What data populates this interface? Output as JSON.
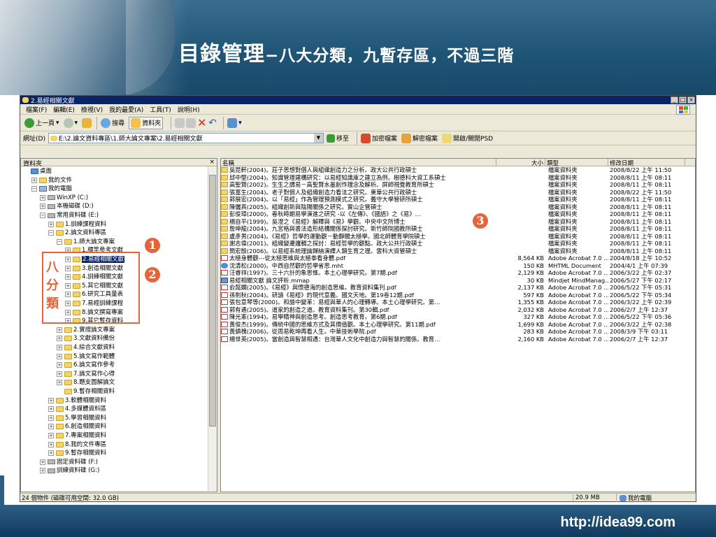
{
  "slide": {
    "title_main": "目錄管理",
    "title_sub": "−八大分類，九暫存區，不過三階",
    "footer_url": "http://idea99.com",
    "category_label_chars": [
      "八",
      "分",
      "類"
    ],
    "callouts": [
      "1",
      "2",
      "3"
    ]
  },
  "window": {
    "title": "2.易經相關文獻",
    "buttons": {
      "min": "_",
      "max": "□",
      "close": "×"
    },
    "menu": [
      "檔案(F)",
      "編輯(E)",
      "檢視(V)",
      "我的最愛(A)",
      "工具(T)",
      "說明(H)"
    ],
    "toolbar": {
      "back": "上一頁",
      "search": "搜尋",
      "folders": "資料夾",
      "views_label": ""
    },
    "address": {
      "label": "網址(D)",
      "value": "E:\\2.論文資料專區\\1.師大論文專案\\2.易經相關文獻",
      "go": "移至",
      "encrypt": "加密檔案",
      "decrypt": "解密檔案",
      "psd": "開啟/關閉PSD"
    },
    "left_pane_title": "資料夾",
    "left_pane_close": "×",
    "tree": [
      {
        "label": "桌面",
        "depth": 0,
        "pm": "",
        "icon": "desktop"
      },
      {
        "label": "我的文件",
        "depth": 1,
        "pm": "+",
        "icon": "folder"
      },
      {
        "label": "我的電腦",
        "depth": 1,
        "pm": "−",
        "icon": "computer"
      },
      {
        "label": "WinXP (C:)",
        "depth": 2,
        "pm": "+",
        "icon": "drive"
      },
      {
        "label": "本機磁碟 (D:)",
        "depth": 2,
        "pm": "+",
        "icon": "drive"
      },
      {
        "label": "常用資料碟 (E:)",
        "depth": 2,
        "pm": "−",
        "icon": "drive"
      },
      {
        "label": "1.訓練課程資料",
        "depth": 3,
        "pm": "+",
        "icon": "folder"
      },
      {
        "label": "2.論文資料專區",
        "depth": 3,
        "pm": "−",
        "icon": "folder"
      },
      {
        "label": "1.師大論文專案",
        "depth": 4,
        "pm": "−",
        "icon": "folder"
      },
      {
        "label": "1.標竿參考文獻",
        "depth": 5,
        "pm": "+",
        "icon": "folder"
      },
      {
        "label": "2.易經相關文獻",
        "depth": 5,
        "pm": "+",
        "icon": "folder",
        "selected": true
      },
      {
        "label": "3.創造相關文獻",
        "depth": 5,
        "pm": "+",
        "icon": "folder"
      },
      {
        "label": "4.訓練相關文獻",
        "depth": 5,
        "pm": "+",
        "icon": "folder"
      },
      {
        "label": "5.其它相關文獻",
        "depth": 5,
        "pm": "+",
        "icon": "folder"
      },
      {
        "label": "6.研究工具量表",
        "depth": 5,
        "pm": "+",
        "icon": "folder"
      },
      {
        "label": "7.易經訓練課程",
        "depth": 5,
        "pm": "+",
        "icon": "folder"
      },
      {
        "label": "8.論文撰寫專案",
        "depth": 5,
        "pm": "+",
        "icon": "folder"
      },
      {
        "label": "9.其它暫存資料",
        "depth": 5,
        "pm": "+",
        "icon": "folder"
      },
      {
        "label": "2.實證論文專案",
        "depth": 4,
        "pm": "+",
        "icon": "folder"
      },
      {
        "label": "3.文獻資料備份",
        "depth": 4,
        "pm": "+",
        "icon": "folder"
      },
      {
        "label": "4.綜合文獻資料",
        "depth": 4,
        "pm": "+",
        "icon": "folder"
      },
      {
        "label": "5.論文寫作範體",
        "depth": 4,
        "pm": "+",
        "icon": "folder"
      },
      {
        "label": "6.論文寫作參考",
        "depth": 4,
        "pm": "+",
        "icon": "folder"
      },
      {
        "label": "7.論文寫作心得",
        "depth": 4,
        "pm": "+",
        "icon": "folder"
      },
      {
        "label": "8.題支圖解論文",
        "depth": 4,
        "pm": "+",
        "icon": "folder"
      },
      {
        "label": "9.暫存相關資料",
        "depth": 4,
        "pm": "",
        "icon": "folder"
      },
      {
        "label": "3.軟體相關資料",
        "depth": 3,
        "pm": "+",
        "icon": "folder"
      },
      {
        "label": "4.多媒體資料區",
        "depth": 3,
        "pm": "+",
        "icon": "folder"
      },
      {
        "label": "5.學習相關資料",
        "depth": 3,
        "pm": "+",
        "icon": "folder"
      },
      {
        "label": "6.創造相關資料",
        "depth": 3,
        "pm": "+",
        "icon": "folder"
      },
      {
        "label": "7.專案相關資料",
        "depth": 3,
        "pm": "+",
        "icon": "folder"
      },
      {
        "label": "8.我的文件專區",
        "depth": 3,
        "pm": "+",
        "icon": "folder"
      },
      {
        "label": "9.暫存相關資料",
        "depth": 3,
        "pm": "+",
        "icon": "folder"
      },
      {
        "label": "固定資料碟 (F:)",
        "depth": 2,
        "pm": "+",
        "icon": "drive"
      },
      {
        "label": "訓練資料碟 (G:)",
        "depth": 2,
        "pm": "+",
        "icon": "drive"
      }
    ],
    "columns": {
      "name": "名稱",
      "size": "大小",
      "type": "類型",
      "date": "修改日期"
    },
    "files": [
      {
        "name": "吳昆軒(2004)。莊子思想對個人與組織創造力之分析。政大公共行政碩士",
        "size": "",
        "type": "檔案資料夾",
        "date": "2008/8/22 上午 11:50",
        "icon": "folder"
      },
      {
        "name": "邱中堅(2004)。知識管理建構研究：以易經知識庫之建立為例。樹德科大資工系碩士",
        "size": "",
        "type": "檔案資料夾",
        "date": "2008/8/11 上午 08:11",
        "icon": "folder"
      },
      {
        "name": "高聖賢(2002)。生生之謂易－高聖賢水墨創作理念及解析。屏師視覺教育所碩士",
        "size": "",
        "type": "檔案資料夾",
        "date": "2008/8/11 上午 08:11",
        "icon": "folder"
      },
      {
        "name": "張富生(2004)。老子對個人及組織創造力看法之研究。東華公共行政碩士",
        "size": "",
        "type": "檔案資料夾",
        "date": "2008/8/22 上午 11:50",
        "icon": "folder"
      },
      {
        "name": "郭展宏(2004)。以「易經」作為管理預測模式之研究。義守大學管研所碩士",
        "size": "",
        "type": "檔案資料夾",
        "date": "2008/8/11 上午 08:11",
        "icon": "folder"
      },
      {
        "name": "陳儷真(2005)。組織創新與陰陽關係之研究。實山企管碩士",
        "size": "",
        "type": "檔案資料夾",
        "date": "2008/8/11 上午 08:11",
        "icon": "folder"
      },
      {
        "name": "彭俊璋(2000)。春秋時期易學演進之研究 -以《左傳》、《國語》之《易》…",
        "size": "",
        "type": "檔案資料夾",
        "date": "2008/8/11 上午 08:11",
        "icon": "folder"
      },
      {
        "name": "楊自平(1999)。吳澄之《易經》解釋與《易》學觀。中央中文所博士",
        "size": "",
        "type": "檔案資料夾",
        "date": "2008/8/11 上午 08:11",
        "icon": "folder"
      },
      {
        "name": "詹坤龍(2004)。九宮格與書法造形結構關係探討研究。新竹師院國教所碩士",
        "size": "",
        "type": "檔案資料夾",
        "date": "2008/8/11 上午 08:11",
        "icon": "folder"
      },
      {
        "name": "盧彥男(2004)。《易經》哲學的運動觀－動靜關太極學。國北師體育學院碩士",
        "size": "",
        "type": "檔案資料夾",
        "date": "2008/8/11 上午 08:11",
        "icon": "folder"
      },
      {
        "name": "謝志偉(2001)。組織變遷邏輯之探討：易經哲學的觀點。政大公共行政碩士",
        "size": "",
        "type": "檔案資料夾",
        "date": "2008/8/11 上午 08:11",
        "icon": "folder"
      },
      {
        "name": "簡宏殷(2006)。以易經系統理論歸納演繹人類生育之理。雲科大資管碩士",
        "size": "",
        "type": "檔案資料夾",
        "date": "2008/8/11 上午 08:11",
        "icon": "folder"
      },
      {
        "name": "太極身體觀---從太極思維與太極拳看身體.pdf",
        "size": "8,564 KB",
        "type": "Adobe Acrobat 7.0 ...",
        "date": "2004/8/18 上午 10:52",
        "icon": "pdf"
      },
      {
        "name": "沈清松(2000)。中西自然觀的哲學省思.mht",
        "size": "150 KB",
        "type": "MHTML Document",
        "date": "2004/4/1 上午 07:39",
        "icon": "mht"
      },
      {
        "name": "汪睿祥(1997)。三十六計的象思惟。本土心理學研究。第7期.pdf",
        "size": "2,129 KB",
        "type": "Adobe Acrobat 7.0 ...",
        "date": "2006/3/22 上午 02:37",
        "icon": "pdf"
      },
      {
        "name": "易經相關文獻 論文評析.mmap",
        "size": "30 KB",
        "type": "Mindjet MindManag...",
        "date": "2006/5/27 下午 02:17",
        "icon": "mmap"
      },
      {
        "name": "俞懿嫻(2005)。《易經》與懷德海的創造思維。教育資料集刊.pdf",
        "size": "2,137 KB",
        "type": "Adobe Acrobat 7.0 ...",
        "date": "2006/5/22 下午 05:31",
        "icon": "pdf"
      },
      {
        "name": "孫劍秋(2004)。研讀《易經》的現代意義。國文天地。第19卷12期.pdf",
        "size": "597 KB",
        "type": "Adobe Acrobat 7.0 ...",
        "date": "2006/5/22 下午 05:34",
        "icon": "pdf"
      },
      {
        "name": "張包意琴等(2000)。和諧中變革：易經與華人的心理轉導。本土心理學研究。第…",
        "size": "1,355 KB",
        "type": "Adobe Acrobat 7.0 ...",
        "date": "2006/3/22 上午 02:39",
        "icon": "pdf"
      },
      {
        "name": "郭有遹(2005)。道家的創造之道。教育資料集刊。第30輯.pdf",
        "size": "2,032 KB",
        "type": "Adobe Acrobat 7.0 ...",
        "date": "2006/2/7 上午 12:37",
        "icon": "pdf"
      },
      {
        "name": "陳光憲(1994)。易學精神與創造思考。創造思考教育。第6期.pdf",
        "size": "327 KB",
        "type": "Adobe Acrobat 7.0 ...",
        "date": "2006/5/22 下午 05:36",
        "icon": "pdf"
      },
      {
        "name": "黃俊杰(1999)。傳統中國的思維方式及其價值觀。本土心理學研究。第11期.pdf",
        "size": "1,699 KB",
        "type": "Adobe Acrobat 7.0 ...",
        "date": "2006/3/22 上午 02:38",
        "icon": "pdf"
      },
      {
        "name": "黃鎮槐(2006)。從周易乾坤再看人生。中華技術學院.pdf",
        "size": "283 KB",
        "type": "Adobe Acrobat 7.0 ...",
        "date": "2008/3/9 下午 03:11",
        "icon": "pdf"
      },
      {
        "name": "楊世英(2005)。當創造與智慧相遇：台灣華人文化中創造力與智慧的關係。教育…",
        "size": "2,160 KB",
        "type": "Adobe Acrobat 7.0 ...",
        "date": "2006/2/7 上午 12:37",
        "icon": "pdf"
      }
    ],
    "status": {
      "left": "24 個物件 (磁碟可用空間: 32.0 GB)",
      "size": "20.9 MB",
      "location": "我的電腦"
    }
  }
}
